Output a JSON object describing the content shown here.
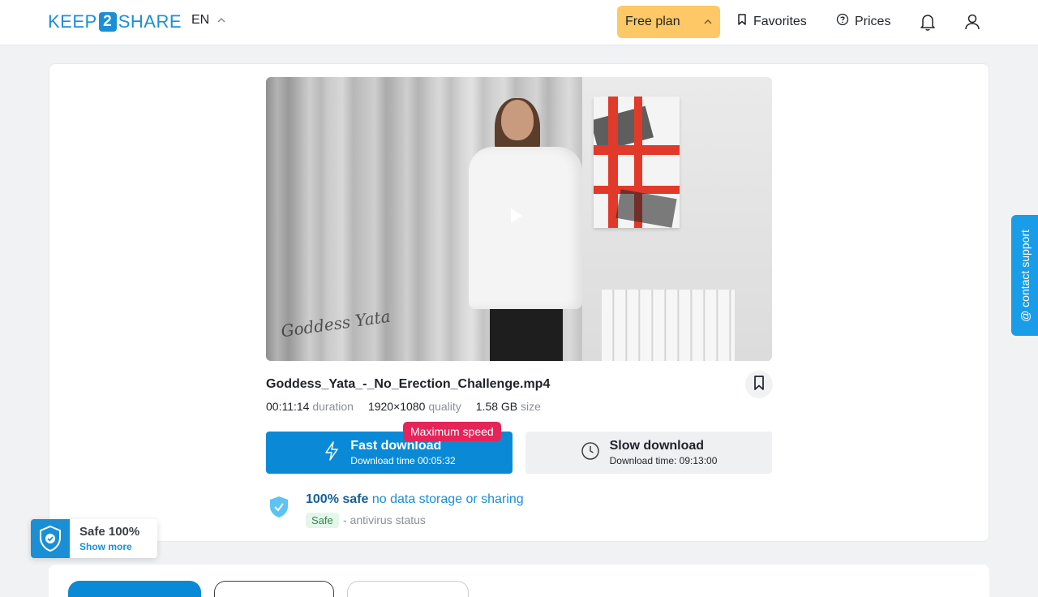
{
  "header": {
    "logo_left": "KEEP",
    "logo_num": "2",
    "logo_right": "SHARE",
    "lang": "EN",
    "free_plan": "Free plan",
    "favorites": "Favorites",
    "prices": "Prices"
  },
  "file": {
    "watermark": "Goddess Yata",
    "name": "Goddess_Yata_-_No_Erection_Challenge.mp4",
    "duration_value": "00:11:14",
    "duration_label": "duration",
    "quality_value": "1920×1080",
    "quality_label": "quality",
    "size_value": "1.58 GB",
    "size_label": "size"
  },
  "download": {
    "badge": "Maximum speed",
    "fast_title": "Fast download",
    "fast_sub": "Download time 00:05:32",
    "slow_title": "Slow download",
    "slow_sub": "Download time: 09:13:00"
  },
  "safety": {
    "bold": "100% safe",
    "text": "no data storage or sharing",
    "pill": "Safe",
    "status": "- antivirus status"
  },
  "contact": "@ contact support",
  "widget": {
    "title": "Safe 100%",
    "link": "Show more"
  },
  "colors": {
    "accent": "#0a8ad6",
    "free_plan_bg": "#ffc866",
    "badge": "#e5245a"
  },
  "icons": [
    "chevron-up-icon",
    "bookmark-icon",
    "question-circle-icon",
    "bell-icon",
    "user-icon",
    "play-icon",
    "lightning-icon",
    "clock-icon",
    "shield-check-icon"
  ]
}
